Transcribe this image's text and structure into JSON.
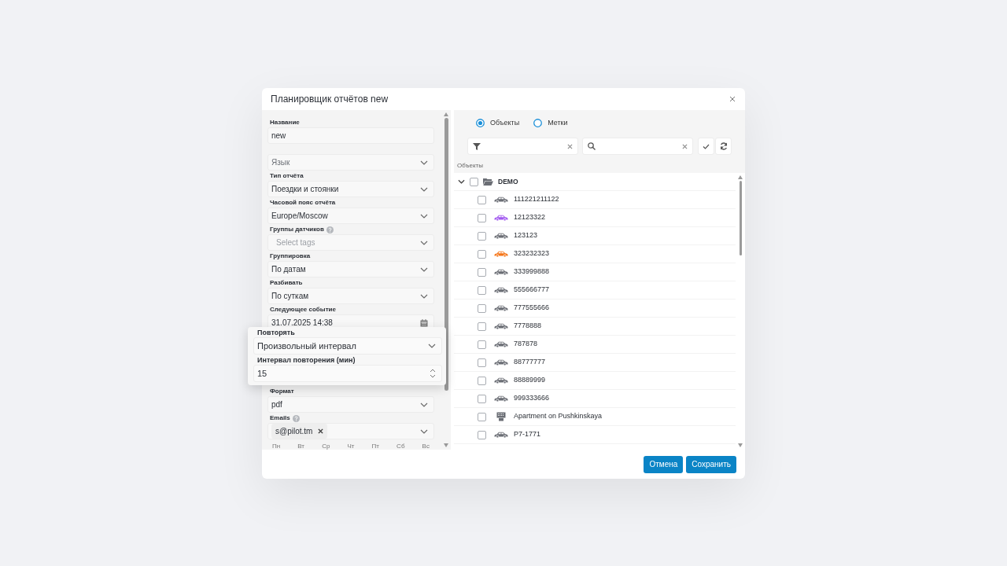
{
  "dialog": {
    "title": "Планировщик отчётов new"
  },
  "form": {
    "fields": [
      {
        "label": "Название",
        "kind": "text",
        "value": "new"
      },
      {
        "kind": "select",
        "placeholder": "Язык"
      },
      {
        "label": "Тип отчёта",
        "kind": "select",
        "value": "Поездки и стоянки"
      },
      {
        "label": "Часовой пояс отчёта",
        "kind": "select",
        "value": "Europe/Moscow"
      },
      {
        "label": "Группы датчиков",
        "help": true,
        "kind": "select",
        "placeholder": "Select tags"
      },
      {
        "label": "Группировка",
        "kind": "select",
        "value": "По датам"
      },
      {
        "label": "Разбивать",
        "kind": "select",
        "value": "По суткам"
      },
      {
        "label": "Следующее событие",
        "kind": "date",
        "value": "31.07.2025 14:38"
      },
      {
        "kind": "hidden"
      },
      {
        "label": "Формат",
        "kind": "select",
        "value": "pdf"
      },
      {
        "label": "Emails",
        "help": true,
        "kind": "tags",
        "tags": [
          "s@pilot.tm"
        ]
      }
    ],
    "weekdays": [
      "Пн",
      "Вт",
      "Ср",
      "Чт",
      "Пт",
      "Сб",
      "Вс"
    ]
  },
  "popup": {
    "fields": [
      {
        "label": "Повторять",
        "kind": "select",
        "value": "Произвольный интервал"
      },
      {
        "label": "Интервал повторения (мин)",
        "kind": "number",
        "value": "15"
      }
    ]
  },
  "objects_panel": {
    "modes": [
      {
        "label": "Объекты",
        "selected": true
      },
      {
        "label": "Метки",
        "selected": false
      }
    ],
    "list_title": "Объекты",
    "tree": {
      "label": "DEMO",
      "expanded": true,
      "checked": false,
      "children": [
        {
          "label": "111221211122",
          "kind": "car",
          "color": "#6b6e75",
          "checked": false
        },
        {
          "label": "12123322",
          "kind": "car",
          "color": "#a259f0",
          "checked": false
        },
        {
          "label": "123123",
          "kind": "car",
          "color": "#6b6e75",
          "checked": false
        },
        {
          "label": "323232323",
          "kind": "car",
          "color": "#f5761a",
          "checked": false
        },
        {
          "label": "333999888",
          "kind": "car",
          "color": "#6b6e75",
          "checked": false
        },
        {
          "label": "555666777",
          "kind": "car",
          "color": "#6b6e75",
          "checked": false
        },
        {
          "label": "777555666",
          "kind": "car",
          "color": "#6b6e75",
          "checked": false
        },
        {
          "label": "7778888",
          "kind": "car",
          "color": "#6b6e75",
          "checked": false
        },
        {
          "label": "787878",
          "kind": "car",
          "color": "#6b6e75",
          "checked": false
        },
        {
          "label": "88777777",
          "kind": "car",
          "color": "#6b6e75",
          "checked": false
        },
        {
          "label": "88889999",
          "kind": "car",
          "color": "#6b6e75",
          "checked": false
        },
        {
          "label": "999333666",
          "kind": "car",
          "color": "#6b6e75",
          "checked": false
        },
        {
          "label": "Apartment on Pushkinskaya",
          "kind": "building",
          "color": "#6b6e75",
          "checked": false
        },
        {
          "label": "P7-1771",
          "kind": "car",
          "color": "#6b6e75",
          "checked": false
        }
      ]
    }
  },
  "buttons": [
    {
      "label": "Отмена"
    },
    {
      "label": "Сохранить"
    }
  ]
}
